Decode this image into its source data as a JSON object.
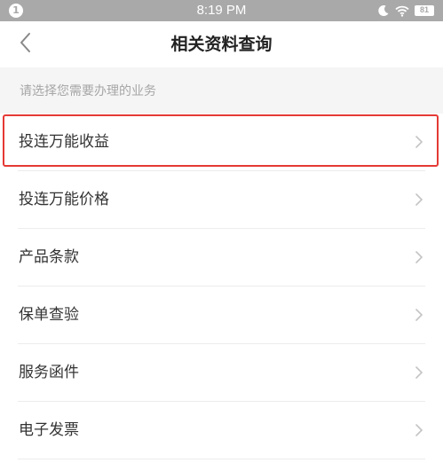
{
  "status_bar": {
    "notification_badge": "1",
    "time": "8:19 PM",
    "battery_level": "81",
    "icons": [
      "moon-icon",
      "wifi-icon",
      "battery-icon"
    ]
  },
  "nav": {
    "title": "相关资料查询",
    "back_icon": "chevron-left-icon"
  },
  "hint": "请选择您需要办理的业务",
  "list": {
    "items": [
      {
        "label": "投连万能收益",
        "highlighted": true
      },
      {
        "label": "投连万能价格"
      },
      {
        "label": "产品条款"
      },
      {
        "label": "保单查验"
      },
      {
        "label": "服务函件"
      },
      {
        "label": "电子发票"
      }
    ]
  },
  "colors": {
    "status_bar_bg": "#a9a9a9",
    "highlight_border": "#e53935",
    "hint_text": "#a6a6a6",
    "page_bg": "#f5f5f5"
  }
}
